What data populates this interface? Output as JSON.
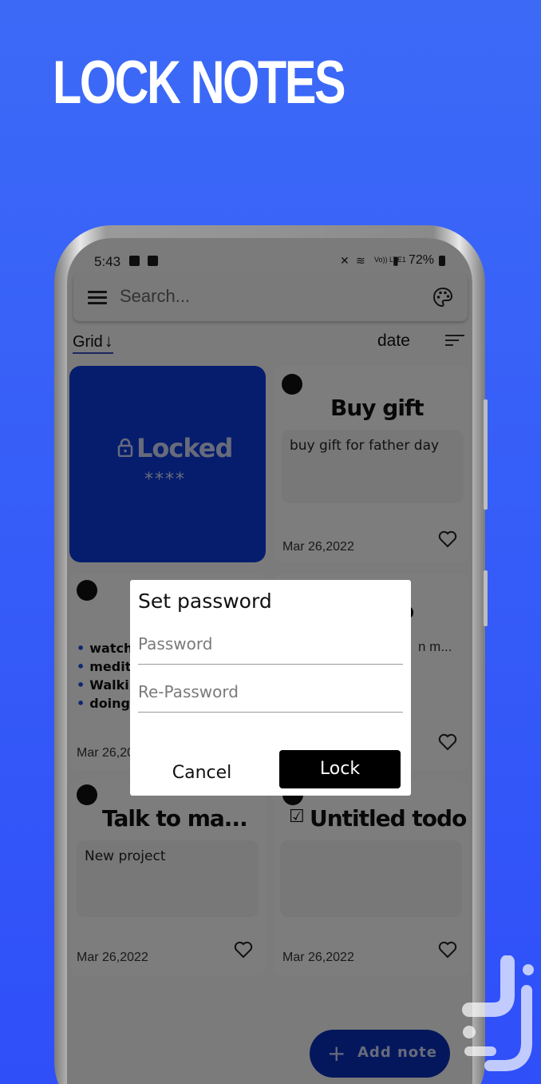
{
  "promo": {
    "title": "LOCK NOTES"
  },
  "status_bar": {
    "time": "5:43",
    "network": "Vo)) LTE1",
    "battery": "72%"
  },
  "search": {
    "placeholder": "Search..."
  },
  "view": {
    "mode_label": "Grid",
    "sort_label": "date"
  },
  "cards": {
    "locked": {
      "title": "Locked",
      "stars": "****"
    },
    "buy_gift": {
      "title": "Buy gift",
      "body": "buy gift for father day",
      "date": "Mar 26,2022"
    },
    "todo_list": {
      "items": [
        "watchi",
        "medita",
        "Walkin",
        "doing l"
      ],
      "date": "Mar 26,20"
    },
    "partial": {
      "title_fragment": "o",
      "body_fragment": "n m..."
    },
    "talk": {
      "title": "Talk to ma...",
      "body": "New project",
      "date": "Mar 26,2022"
    },
    "untitled": {
      "title": "Untitled todo",
      "date": "Mar 26,2022"
    }
  },
  "dialog": {
    "title": "Set password",
    "password_placeholder": "Password",
    "repassword_placeholder": "Re-Password",
    "cancel_label": "Cancel",
    "lock_label": "Lock"
  },
  "fab": {
    "label": "Add note",
    "icon": "+"
  },
  "colors": {
    "background": "#3c6af7",
    "locked_card": "#0c3bdc",
    "fab": "#0b2fb8",
    "accent_underline": "#3a4ec0"
  }
}
